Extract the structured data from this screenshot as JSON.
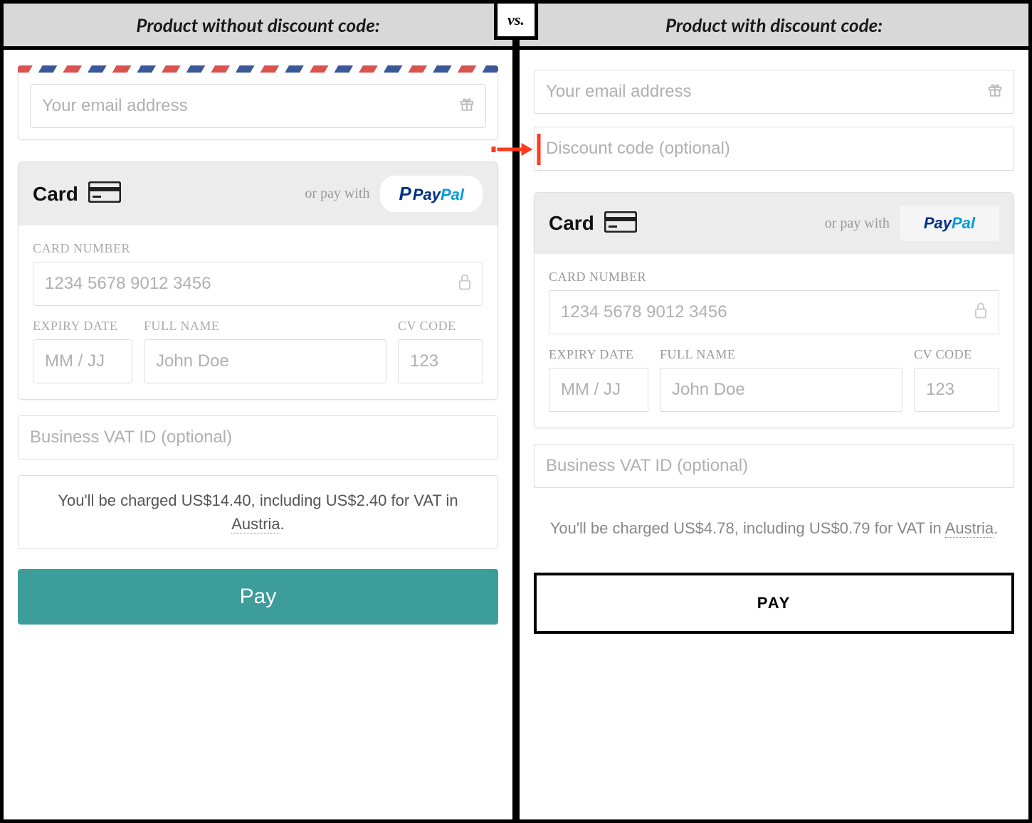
{
  "vs": "vs.",
  "left": {
    "header": "Product without discount code:",
    "email_placeholder": "Your email address",
    "payment": {
      "card_label": "Card",
      "or_pay": "or pay with",
      "paypal_pay": "Pay",
      "paypal_pal": "Pal",
      "card_number_label": "CARD NUMBER",
      "card_number_placeholder": "1234 5678 9012 3456",
      "expiry_label": "EXPIRY DATE",
      "expiry_placeholder": "MM / JJ",
      "name_label": "FULL NAME",
      "name_placeholder": "John Doe",
      "cv_label": "CV CODE",
      "cv_placeholder": "123"
    },
    "vat_placeholder": "Business VAT ID (optional)",
    "charge_prefix": "You'll be charged US$14.40, including US$2.40 for VAT in ",
    "charge_country": "Austria",
    "charge_suffix": ".",
    "pay_button": "Pay"
  },
  "right": {
    "header": "Product with discount code:",
    "email_placeholder": "Your email address",
    "discount_placeholder": "Discount code (optional)",
    "payment": {
      "card_label": "Card",
      "or_pay": "or pay with",
      "paypal_pay": "Pay",
      "paypal_pal": "Pal",
      "card_number_label": "CARD NUMBER",
      "card_number_placeholder": "1234 5678 9012 3456",
      "expiry_label": "EXPIRY DATE",
      "expiry_placeholder": "MM / JJ",
      "name_label": "FULL NAME",
      "name_placeholder": "John Doe",
      "cv_label": "CV CODE",
      "cv_placeholder": "123"
    },
    "vat_placeholder": "Business VAT ID (optional)",
    "charge_prefix": "You'll be charged US$4.78, including US$0.79 for VAT in ",
    "charge_country": "Austria",
    "charge_suffix": ".",
    "pay_button": "PAY"
  }
}
